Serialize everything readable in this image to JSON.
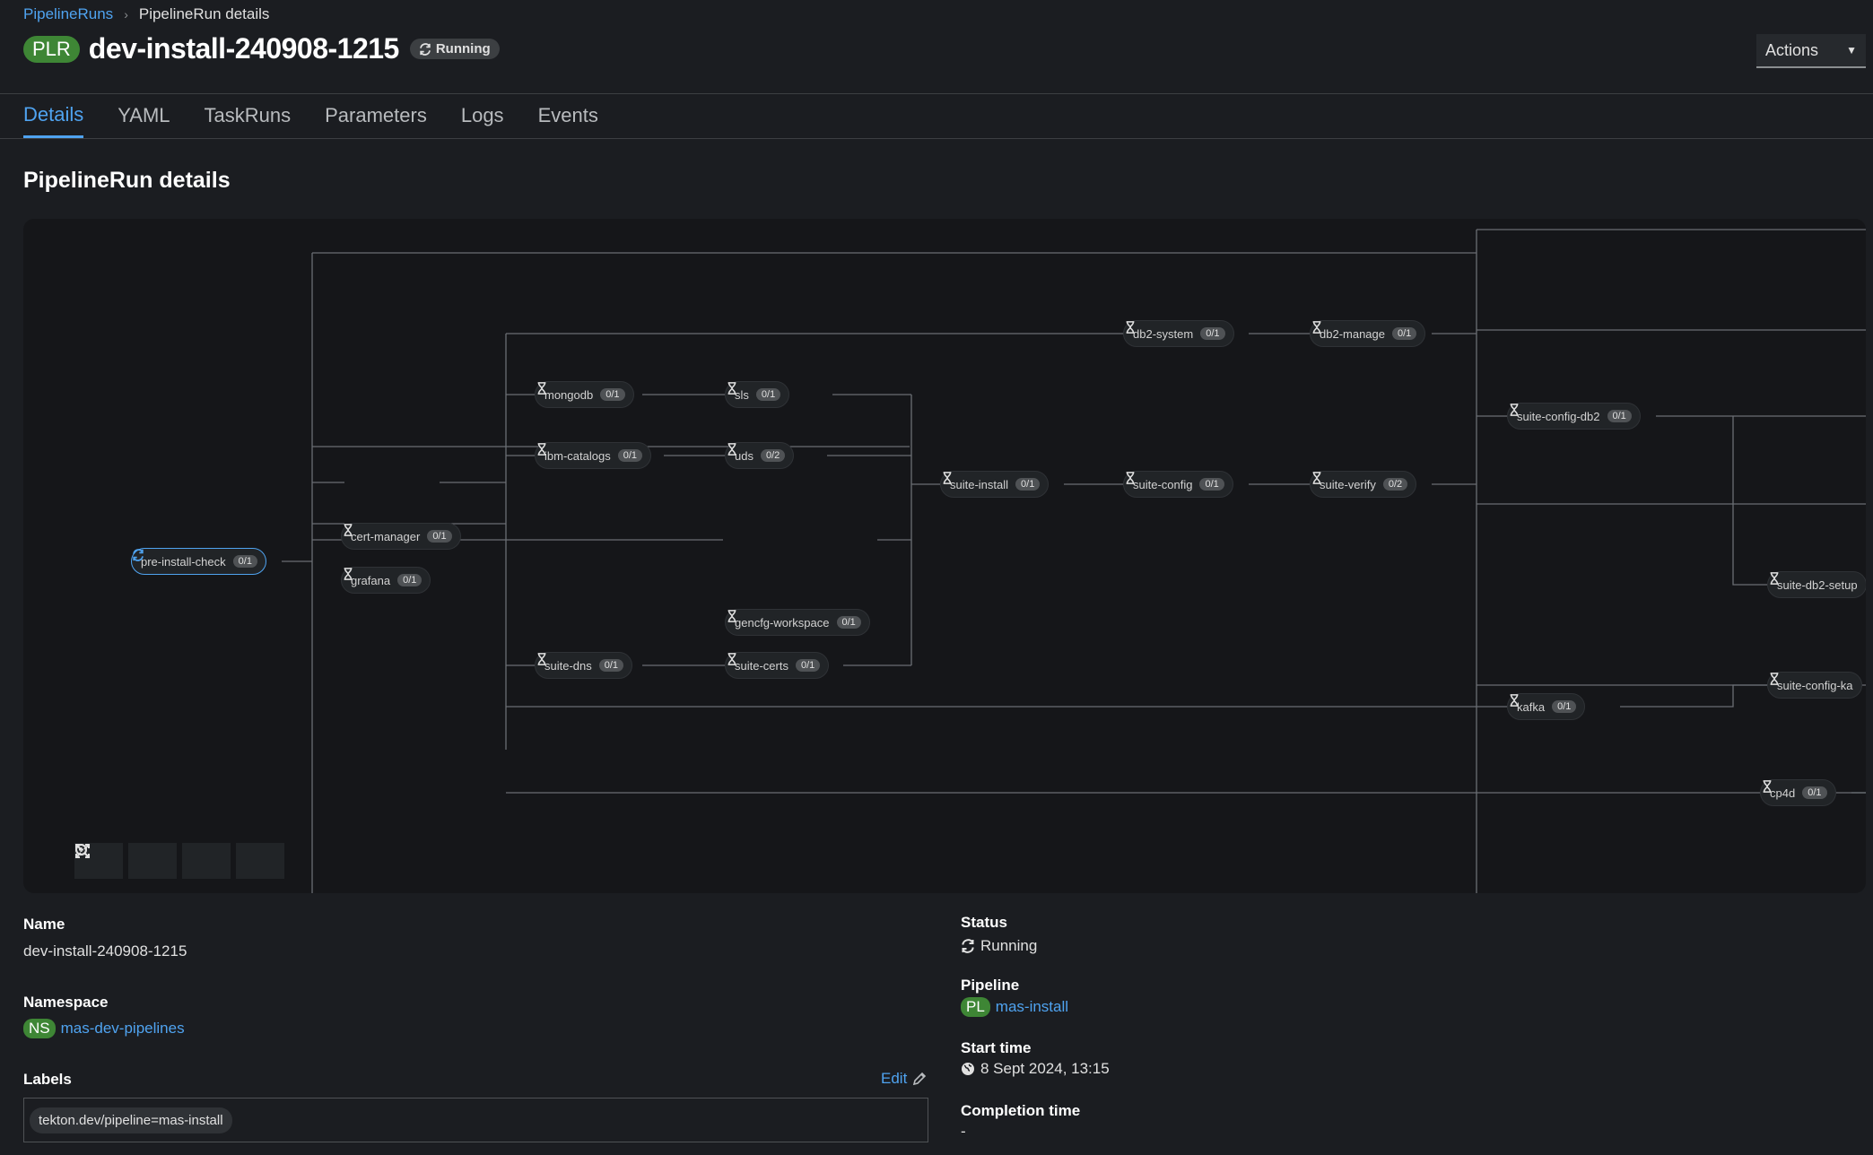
{
  "breadcrumb": {
    "parent": "PipelineRuns",
    "current": "PipelineRun details"
  },
  "header": {
    "badge": "PLR",
    "title": "dev-install-240908-1215",
    "status": "Running",
    "actions_label": "Actions"
  },
  "tabs": [
    {
      "label": "Details",
      "active": true
    },
    {
      "label": "YAML"
    },
    {
      "label": "TaskRuns"
    },
    {
      "label": "Parameters"
    },
    {
      "label": "Logs"
    },
    {
      "label": "Events"
    }
  ],
  "section_title": "PipelineRun details",
  "graph": {
    "nodes": [
      {
        "name": "pre-install-check",
        "count": "0/1",
        "status": "running"
      },
      {
        "name": "cert-manager",
        "count": "0/1"
      },
      {
        "name": "grafana",
        "count": "0/1"
      },
      {
        "name": "mongodb",
        "count": "0/1"
      },
      {
        "name": "ibm-catalogs",
        "count": "0/1"
      },
      {
        "name": "sls",
        "count": "0/1"
      },
      {
        "name": "uds",
        "count": "0/2"
      },
      {
        "name": "gencfg-workspace",
        "count": "0/1"
      },
      {
        "name": "suite-dns",
        "count": "0/1"
      },
      {
        "name": "suite-certs",
        "count": "0/1"
      },
      {
        "name": "suite-install",
        "count": "0/1"
      },
      {
        "name": "db2-system",
        "count": "0/1"
      },
      {
        "name": "suite-config",
        "count": "0/1"
      },
      {
        "name": "db2-manage",
        "count": "0/1"
      },
      {
        "name": "suite-verify",
        "count": "0/2"
      },
      {
        "name": "suite-config-db2",
        "count": "0/1"
      },
      {
        "name": "kafka",
        "count": "0/1"
      },
      {
        "name": "suite-db2-setup",
        "visible_text": "suite-db2-setup"
      },
      {
        "name": "suite-config-kafka",
        "visible_text": "suite-config-ka"
      },
      {
        "name": "cp4d",
        "count": "0/1"
      }
    ],
    "controls": [
      "zoom-in-icon",
      "zoom-out-icon",
      "fit-to-screen-icon",
      "expand-icon"
    ]
  },
  "details": {
    "name_label": "Name",
    "name_value": "dev-install-240908-1215",
    "namespace_label": "Namespace",
    "namespace_badge": "NS",
    "namespace_value": "mas-dev-pipelines",
    "labels_label": "Labels",
    "edit_label": "Edit",
    "labels": [
      "tekton.dev/pipeline=mas-install"
    ],
    "status_label": "Status",
    "status_value": "Running",
    "pipeline_label": "Pipeline",
    "pipeline_badge": "PL",
    "pipeline_value": "mas-install",
    "start_label": "Start time",
    "start_value": "8 Sept 2024, 13:15",
    "completion_label": "Completion time",
    "completion_value": "-"
  },
  "colors": {
    "accent": "#4fa3f0",
    "badge_green": "#3e8635",
    "background": "#1b1d21",
    "graph_bg": "#151619"
  }
}
